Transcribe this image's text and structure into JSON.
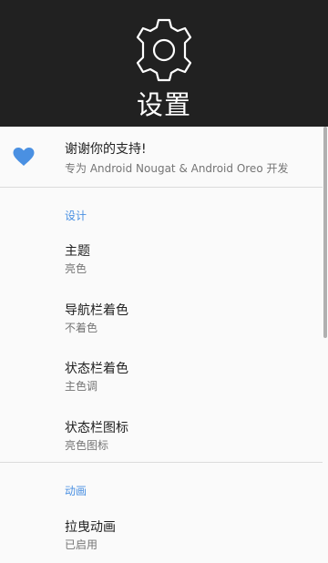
{
  "header": {
    "title": "设置",
    "icon": "gear-icon"
  },
  "support": {
    "icon": "heart-icon",
    "icon_color": "#4a90e2",
    "title": "谢谢你的支持!",
    "subtitle": "专为 Android Nougat & Android Oreo 开发"
  },
  "sections": {
    "design": {
      "label": "设计",
      "items": [
        {
          "title": "主题",
          "value": "亮色"
        },
        {
          "title": "导航栏着色",
          "value": "不着色"
        },
        {
          "title": "状态栏着色",
          "value": "主色调"
        },
        {
          "title": "状态栏图标",
          "value": "亮色图标"
        }
      ]
    },
    "animation": {
      "label": "动画",
      "items": [
        {
          "title": "拉曳动画",
          "value": "已启用"
        }
      ]
    }
  },
  "colors": {
    "header_bg": "#212121",
    "accent": "#4a90e2",
    "background": "#fafafa"
  }
}
